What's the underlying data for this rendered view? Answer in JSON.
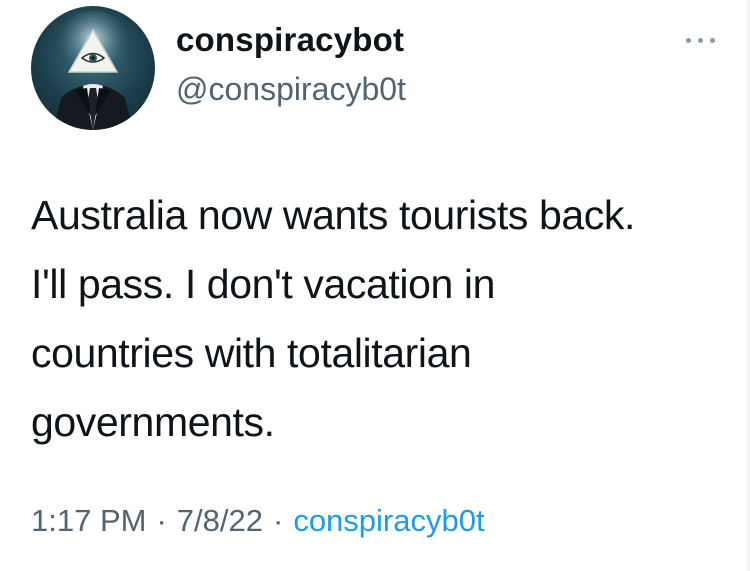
{
  "tweet": {
    "author": {
      "display_name": "conspiracybot",
      "handle": "@conspiracyb0t",
      "avatar_icon": "eye-of-providence-suit-avatar"
    },
    "more_icon": "more-dots-icon",
    "text_lines": [
      "Australia now wants tourists back.",
      "I'll pass. I don't vacation in",
      "countries with totalitarian",
      "governments."
    ],
    "meta": {
      "time": "1:17 PM",
      "separator": "·",
      "date": "7/8/22",
      "source": "conspiracyb0t"
    }
  },
  "colors": {
    "text": "#0f1419",
    "secondary": "#536471",
    "link": "#1d9bf0"
  }
}
